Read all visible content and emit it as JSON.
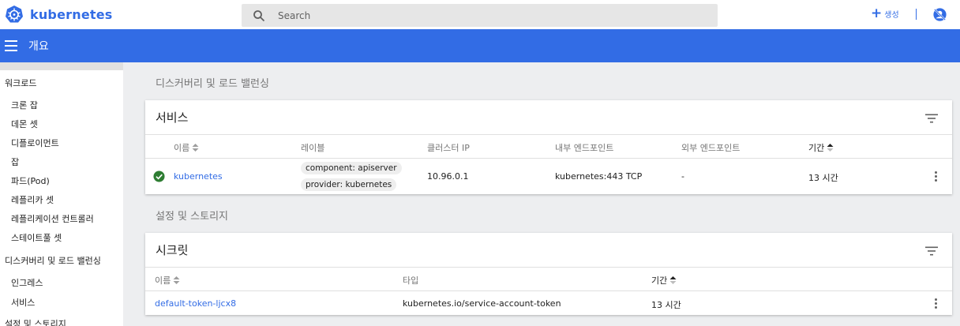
{
  "app": {
    "brand": "kubernetes"
  },
  "search": {
    "placeholder": "Search"
  },
  "header": {
    "create_label": "생성"
  },
  "toolbar": {
    "title": "개요"
  },
  "sidebar": {
    "items": [
      {
        "label": "워크로드",
        "level": "group"
      },
      {
        "label": "크론 잡",
        "level": "sub"
      },
      {
        "label": "데몬 셋",
        "level": "sub"
      },
      {
        "label": "디플로이먼트",
        "level": "sub"
      },
      {
        "label": "잡",
        "level": "sub"
      },
      {
        "label": "파드(Pod)",
        "level": "sub"
      },
      {
        "label": "레플리카 셋",
        "level": "sub"
      },
      {
        "label": "레플리케이션 컨트롤러",
        "level": "sub"
      },
      {
        "label": "스테이트풀 셋",
        "level": "sub"
      },
      {
        "label": "디스커버리 및 로드 밸런싱",
        "level": "group"
      },
      {
        "label": "인그레스",
        "level": "sub"
      },
      {
        "label": "서비스",
        "level": "sub"
      },
      {
        "label": "설정 및 스토리지",
        "level": "group"
      }
    ]
  },
  "discovery": {
    "heading": "디스커버리 및 로드 밸런싱",
    "services": {
      "title": "서비스",
      "columns": [
        "이름",
        "레이블",
        "클러스터 IP",
        "내부 엔드포인트",
        "외부 엔드포인트",
        "기간"
      ],
      "rows": [
        {
          "status": "ok",
          "name": "kubernetes",
          "labels": [
            "component: apiserver",
            "provider: kubernetes"
          ],
          "cluster_ip": "10.96.0.1",
          "internal_endpoint": "kubernetes:443 TCP",
          "external_endpoint": "-",
          "age": "13 시간"
        }
      ]
    }
  },
  "config": {
    "heading": "설정 및 스토리지",
    "secrets": {
      "title": "시크릿",
      "columns": [
        "이름",
        "타입",
        "기간"
      ],
      "rows": [
        {
          "name": "default-token-ljcx8",
          "type": "kubernetes.io/service-account-token",
          "age": "13 시간"
        }
      ]
    }
  },
  "colors": {
    "accent": "#326ce5",
    "status_ok": "#2e7d32"
  }
}
